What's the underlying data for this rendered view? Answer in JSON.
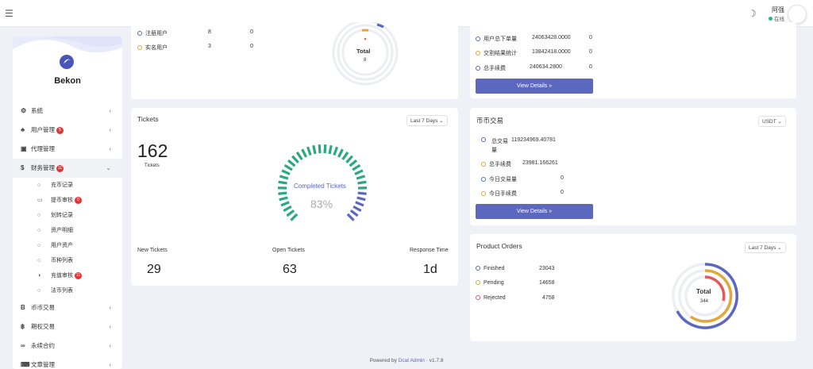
{
  "header": {
    "user_name": "阿强",
    "user_status": "在线"
  },
  "sidebar": {
    "brand": "Bekon",
    "items": [
      {
        "label": "系统",
        "icon": "gear-icon"
      },
      {
        "label": "用户管理",
        "icon": "users-icon",
        "badge": "5"
      },
      {
        "label": "代理管理",
        "icon": "id-card-icon"
      },
      {
        "label": "财务管理",
        "icon": "dollar-icon",
        "badge": "11"
      }
    ],
    "sub_items": [
      {
        "label": "充币记录",
        "badge": ""
      },
      {
        "label": "提币审核",
        "badge": "0"
      },
      {
        "label": "划转记录",
        "badge": ""
      },
      {
        "label": "资产明细",
        "badge": ""
      },
      {
        "label": "用户资产",
        "badge": ""
      },
      {
        "label": "币种列表",
        "badge": ""
      },
      {
        "label": "充值审核",
        "badge": "11"
      },
      {
        "label": "法币列表",
        "badge": ""
      }
    ],
    "more_items": [
      {
        "label": "币币交易"
      },
      {
        "label": "期权交易"
      },
      {
        "label": "永续合约"
      },
      {
        "label": "文章管理"
      }
    ]
  },
  "users_card": {
    "rows": [
      {
        "label": "注册用户",
        "v1": "8",
        "v2": "0",
        "color": "#5c67bf"
      },
      {
        "label": "实名用户",
        "v1": "3",
        "v2": "0",
        "color": "#e0a83a"
      }
    ],
    "donut_title": "Total",
    "donut_value": "8"
  },
  "finance_card": {
    "rows": [
      {
        "label": "用户总下单量",
        "value": "24063428.0000",
        "v2": "0",
        "color": "#5c67bf"
      },
      {
        "label": "交割结果统计",
        "value": "13842418.0000",
        "v2": "0",
        "color": "#e0a83a"
      },
      {
        "label": "总手续费",
        "value": "240634.2800",
        "v2": "0",
        "color": "#5c67bf"
      }
    ],
    "button": "View Details »"
  },
  "tickets_card": {
    "title": "Tickets",
    "select": "Last 7 Days ⌄",
    "count": "162",
    "count_label": "Tickets",
    "gauge_label": "Completed Tickets",
    "gauge_value": "83%",
    "gauge_fraction": 0.83,
    "stats": [
      {
        "label": "New Tickets",
        "value": "29"
      },
      {
        "label": "Open Tickets",
        "value": "63"
      },
      {
        "label": "Response Time",
        "value": "1d"
      }
    ]
  },
  "coin_card": {
    "title": "币币交易",
    "select": "USDT ⌄",
    "rows": [
      {
        "label": "总交易量",
        "value": "119234969.40781",
        "color": "#5c67bf"
      },
      {
        "label": "总手续费",
        "value": "23981.166261",
        "color": "#e0a83a"
      },
      {
        "label": "今日交易量",
        "value": "0",
        "color": "#5c67bf"
      },
      {
        "label": "今日手续费",
        "value": "0",
        "color": "#e0a83a"
      }
    ],
    "button": "View Details »"
  },
  "orders_card": {
    "title": "Product Orders",
    "select": "Last 7 Days ⌄",
    "rows": [
      {
        "label": "Finished",
        "value": "23043",
        "color": "#5c67bf"
      },
      {
        "label": "Pending",
        "value": "14658",
        "color": "#e0a83a"
      },
      {
        "label": "Rejected",
        "value": "4758",
        "color": "#e05b5b"
      }
    ],
    "donut_title": "Total",
    "donut_value": "344"
  },
  "footer": {
    "prefix": "Powered by",
    "link": "Dcat Admin",
    "sep": "·",
    "version": "v1.7.8"
  },
  "colors": {
    "accent": "#5c67bf",
    "teal": "#2aa87e",
    "orange": "#e0a83a",
    "red": "#e05b5b"
  }
}
